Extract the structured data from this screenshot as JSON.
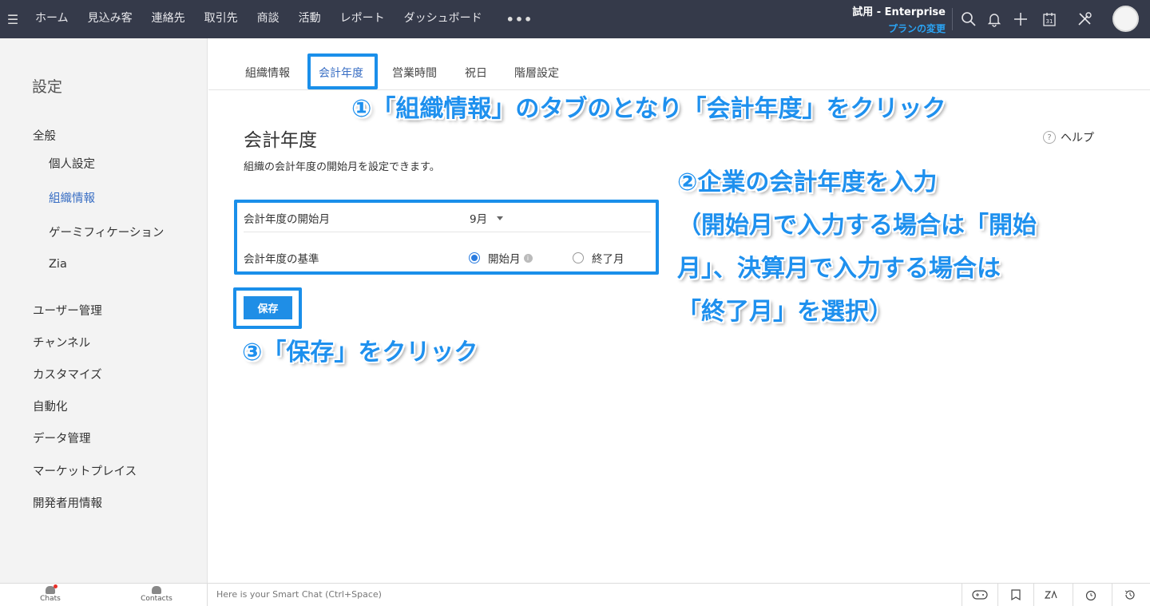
{
  "topnav": {
    "menu_items": [
      "ホーム",
      "見込み客",
      "連絡先",
      "取引先",
      "商談",
      "活動",
      "レポート",
      "ダッシュボード"
    ],
    "more": "•••",
    "plan_trial": "試用 - Enterprise",
    "plan_change": "プランの変更",
    "icons": [
      "search-icon",
      "bell-icon",
      "plus-icon",
      "calendar-icon",
      "tools-icon"
    ],
    "calendar_day": "31"
  },
  "sidebar": {
    "title": "設定",
    "general_label": "全般",
    "sub_items": [
      "個人設定",
      "組織情報",
      "ゲーミフィケーション",
      "Zia"
    ],
    "active_sub_item": "組織情報",
    "items": [
      "ユーザー管理",
      "チャンネル",
      "カスタマイズ",
      "自動化",
      "データ管理",
      "マーケットプレイス",
      "開発者用情報"
    ]
  },
  "tabs": {
    "items": [
      "組織情報",
      "会計年度",
      "営業時間",
      "祝日",
      "階層設定"
    ],
    "active": "会計年度"
  },
  "main": {
    "title": "会計年度",
    "description": "組織の会計年度の開始月を設定できます。",
    "help_label": "ヘルプ",
    "start_month_label": "会計年度の開始月",
    "start_month_value": "9月",
    "basis_label": "会計年度の基準",
    "basis_options": [
      "開始月",
      "終了月"
    ],
    "basis_selected": "開始月",
    "save_label": "保存"
  },
  "annotations": {
    "step1": "①「組織情報」のタブのとなり「会計年度」をクリック",
    "step2_line1": "②企業の会計年度を入力",
    "step2_line2": "（開始月で入力する場合は「開始",
    "step2_line3": "月」、決算月で入力する場合は",
    "step2_line4": "「終了月」を選択）",
    "step3": "③「保存」をクリック",
    "color": "#1e90ee"
  },
  "bottombar": {
    "chats_label": "Chats",
    "contacts_label": "Contacts",
    "smartchat_placeholder": "Here is your Smart Chat (Ctrl+Space)",
    "right_icons": [
      "gamepad-icon",
      "feed-icon",
      "zia-icon",
      "alarm-icon",
      "history-icon"
    ]
  }
}
